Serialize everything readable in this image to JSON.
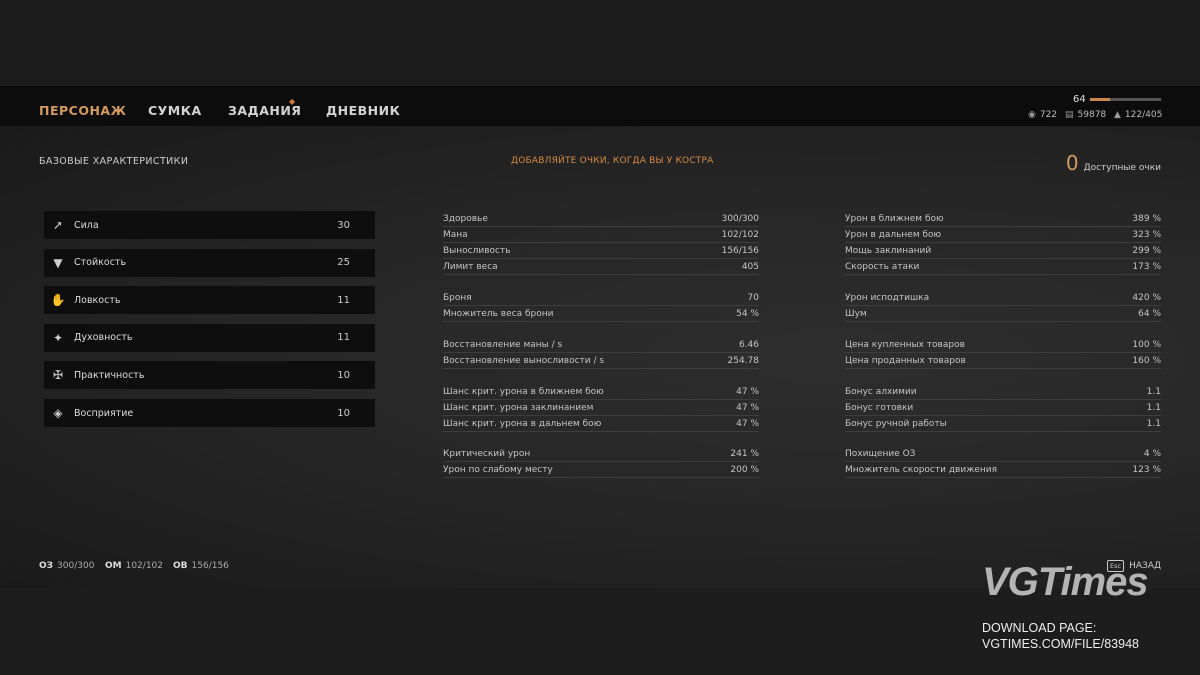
{
  "tabs": [
    {
      "label": "ПЕРСОНАЖ"
    },
    {
      "label": "СУМКА"
    },
    {
      "label": "ЗАДАНИЯ"
    },
    {
      "label": "ДНЕВНИК"
    }
  ],
  "level": "64",
  "xp_fraction": 0.28,
  "resources": {
    "coins": "722",
    "money": "59878",
    "weight": "122/405"
  },
  "section_title": "БАЗОВЫЕ ХАРАКТЕРИСТИКИ",
  "hint": "ДОБАВЛЯЙТЕ ОЧКИ, КОГДА ВЫ У КОСТРА",
  "points": {
    "value": "0",
    "label": "Доступные очки"
  },
  "attributes": [
    {
      "name": "Сила",
      "value": "30",
      "icon": "arm-icon"
    },
    {
      "name": "Стойкость",
      "value": "25",
      "icon": "shield-icon"
    },
    {
      "name": "Ловкость",
      "value": "11",
      "icon": "hand-icon"
    },
    {
      "name": "Духовность",
      "value": "11",
      "icon": "orb-icon"
    },
    {
      "name": "Практичность",
      "value": "10",
      "icon": "tool-icon"
    },
    {
      "name": "Восприятие",
      "value": "10",
      "icon": "eye-icon"
    }
  ],
  "stats_left": [
    [
      {
        "l": "Здоровье",
        "v": "300/300"
      },
      {
        "l": "Мана",
        "v": "102/102"
      },
      {
        "l": "Выносливость",
        "v": "156/156"
      },
      {
        "l": "Лимит веса",
        "v": "405"
      }
    ],
    [
      {
        "l": "Броня",
        "v": "70"
      },
      {
        "l": "Множитель веса брони",
        "v": "54 %"
      }
    ],
    [
      {
        "l": "Восстановление маны / s",
        "v": "6.46"
      },
      {
        "l": "Восстановление выносливости / s",
        "v": "254.78"
      }
    ],
    [
      {
        "l": "Шанс крит. урона в ближнем бою",
        "v": "47 %"
      },
      {
        "l": "Шанс крит. урона заклинанием",
        "v": "47 %"
      },
      {
        "l": "Шанс крит. урона в дальнем бою",
        "v": "47 %"
      }
    ],
    [
      {
        "l": "Критический урон",
        "v": "241 %"
      },
      {
        "l": "Урон по слабому месту",
        "v": "200 %"
      }
    ]
  ],
  "stats_right": [
    [
      {
        "l": "Урон в ближнем бою",
        "v": "389 %"
      },
      {
        "l": "Урон в дальнем бою",
        "v": "323 %"
      },
      {
        "l": "Мощь заклинаний",
        "v": "299 %"
      },
      {
        "l": "Скорость атаки",
        "v": "173 %"
      }
    ],
    [
      {
        "l": "Урон исподтишка",
        "v": "420 %"
      },
      {
        "l": "Шум",
        "v": "64 %"
      }
    ],
    [
      {
        "l": "Цена купленных товаров",
        "v": "100 %"
      },
      {
        "l": "Цена проданных товаров",
        "v": "160 %"
      }
    ],
    [
      {
        "l": "Бонус алхимии",
        "v": "1.1"
      },
      {
        "l": "Бонус готовки",
        "v": "1.1"
      },
      {
        "l": "Бонус ручной работы",
        "v": "1.1"
      }
    ],
    [
      {
        "l": "Похищение ОЗ",
        "v": "4 %"
      },
      {
        "l": "Множитель скорости движения",
        "v": "123 %"
      }
    ]
  ],
  "footer": {
    "hp_label": "ОЗ",
    "hp": "300/300",
    "mp_label": "ОМ",
    "mp": "102/102",
    "st_label": "ОВ",
    "st": "156/156",
    "esc": "Esc",
    "back": "НАЗАД"
  },
  "watermark": {
    "logo": "VGTimes",
    "line1": "DOWNLOAD PAGE:",
    "line2": "VGTIMES.COM/FILE/83948"
  }
}
